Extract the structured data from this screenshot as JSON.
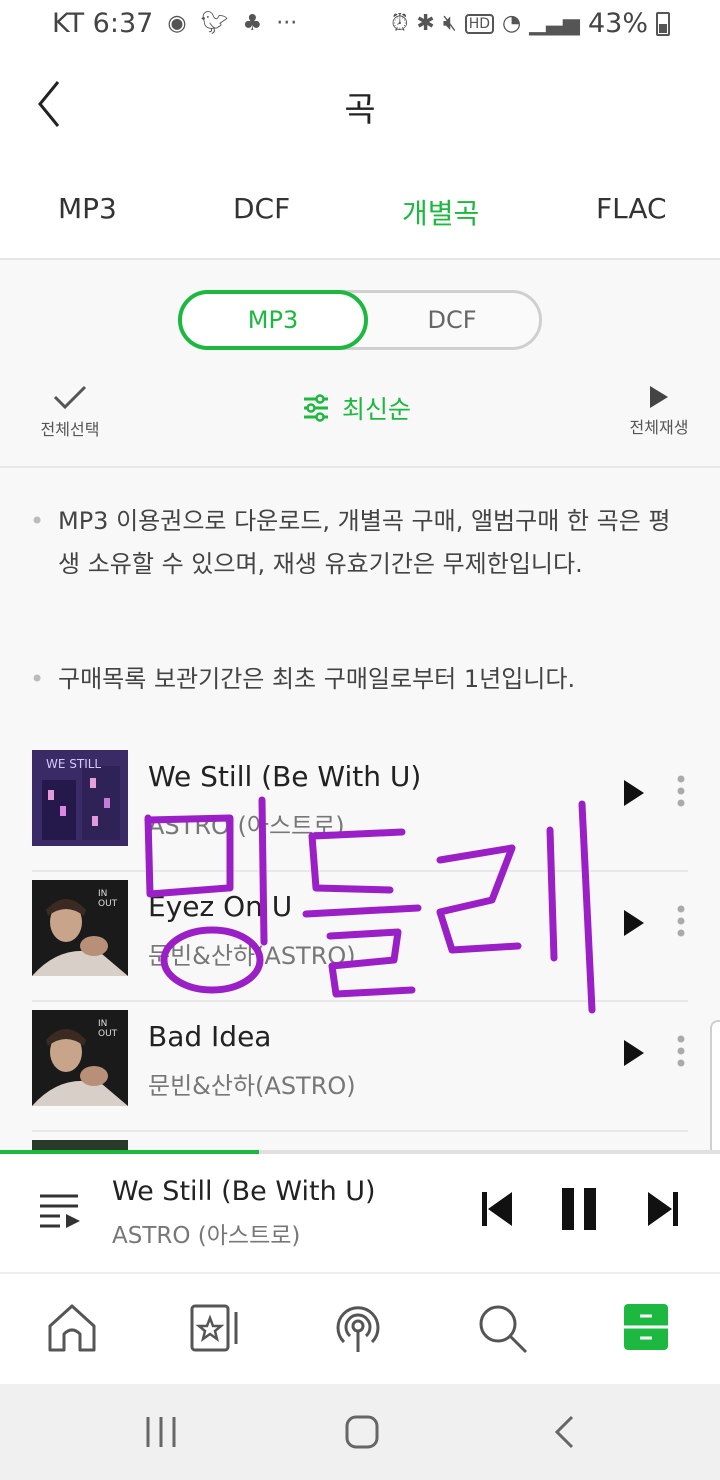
{
  "status_bar": {
    "carrier_time": "KT 6:37",
    "battery": "43%",
    "left_icons": [
      "record-icon",
      "twitter-icon",
      "hanging-figure-icon",
      "more-dots-icon"
    ],
    "right_icons": [
      "alarm-icon",
      "bluetooth-icon",
      "mute-icon",
      "hd-icon",
      "wifi-icon",
      "signal-icon",
      "battery-icon"
    ]
  },
  "header": {
    "title": "곡"
  },
  "tabs": [
    {
      "label": "MP3",
      "active": false
    },
    {
      "label": "DCF",
      "active": false
    },
    {
      "label": "개별곡",
      "active": true
    },
    {
      "label": "FLAC",
      "active": false
    }
  ],
  "format_toggle": {
    "on_label": "MP3",
    "off_label": "DCF"
  },
  "toolbar": {
    "select_all": "전체선택",
    "sort": "최신순",
    "play_all": "전체재생"
  },
  "notices": [
    "MP3 이용권으로 다운로드, 개별곡 구매, 앨범구매 한 곡은 평생 소유할 수 있으며, 재생 유효기간은 무제한입니다.",
    "구매목록 보관기간은 최초 구매일로부터 1년입니다."
  ],
  "songs": [
    {
      "title": "We Still (Be With U)",
      "artist": "ASTRO (아스트로)"
    },
    {
      "title": "Eyez On U",
      "artist": "문빈&산하(ASTRO)"
    },
    {
      "title": "Bad Idea",
      "artist": "문빈&산하(ASTRO)"
    }
  ],
  "annotation": {
    "handwritten_text": "밍들리"
  },
  "now_playing": {
    "title": "We Still (Be With U)",
    "artist": "ASTRO (아스트로)",
    "progress": 0.36
  },
  "bottom_nav": [
    "home-icon",
    "my-music-star-icon",
    "podcast-icon",
    "search-icon",
    "storage-drawer-icon"
  ],
  "colors": {
    "accent": "#1db83f",
    "annotation": "#9b1fc6"
  }
}
